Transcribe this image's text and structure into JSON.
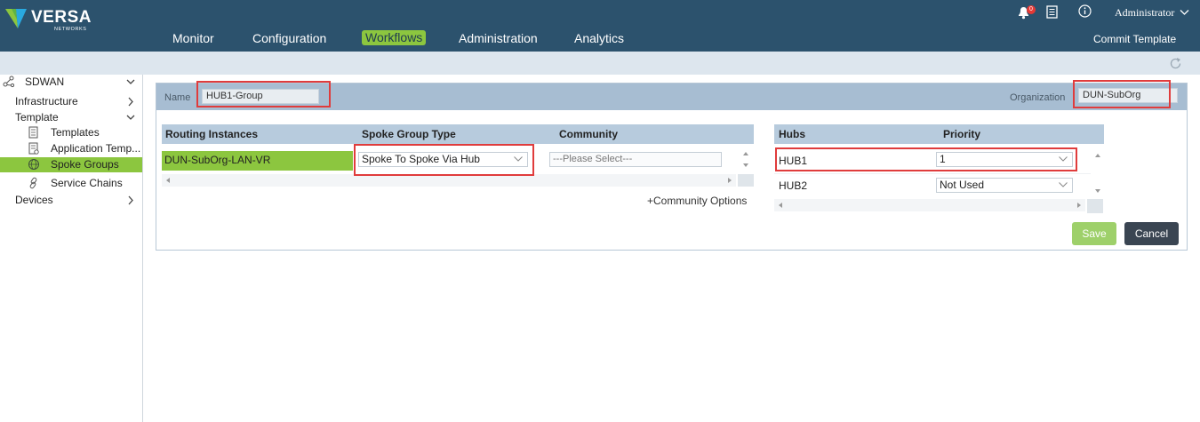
{
  "brand": {
    "name": "VERSA",
    "sub": "NETWORKS"
  },
  "nav": [
    "Monitor",
    "Configuration",
    "Workflows",
    "Administration",
    "Analytics"
  ],
  "nav_active": "Workflows",
  "header_right": {
    "notification_count": "0",
    "user": "Administrator",
    "commit": "Commit Template"
  },
  "sidebar": {
    "root": "SDWAN",
    "infrastructure": "Infrastructure",
    "template": "Template",
    "templates": "Templates",
    "application_templates": "Application Temp...",
    "spoke_groups": "Spoke Groups",
    "service_chains": "Service Chains",
    "devices": "Devices"
  },
  "form": {
    "name_label": "Name",
    "name_value": "HUB1-Group",
    "org_label": "Organization",
    "org_value": "DUN-SubOrg"
  },
  "routing_table": {
    "headers": [
      "Routing Instances",
      "Spoke Group Type",
      "Community"
    ],
    "row": {
      "instance": "DUN-SubOrg-LAN-VR",
      "type": "Spoke To Spoke Via Hub",
      "community_placeholder": "---Please Select---"
    },
    "community_options": "+Community Options"
  },
  "hubs_table": {
    "headers": [
      "Hubs",
      "Priority"
    ],
    "rows": [
      {
        "hub": "HUB1",
        "priority": "1"
      },
      {
        "hub": "HUB2",
        "priority": "Not Used"
      }
    ]
  },
  "buttons": {
    "save": "Save",
    "cancel": "Cancel"
  },
  "colors": {
    "topbar": "#2c526d",
    "accent": "#8cc63f",
    "highlight": "#e03c3c",
    "cancel": "#3a4552"
  }
}
